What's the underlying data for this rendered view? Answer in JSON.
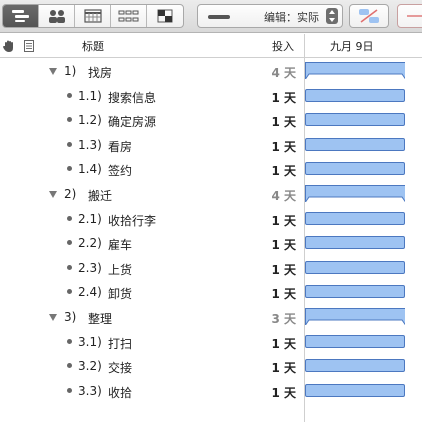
{
  "toolbar": {
    "view_buttons": [
      {
        "icon": "outline-view-icon",
        "active": true
      },
      {
        "icon": "resources-view-icon",
        "active": false
      },
      {
        "icon": "calendar-view-icon",
        "active": false
      },
      {
        "icon": "network-view-icon",
        "active": false
      },
      {
        "icon": "styles-view-icon",
        "active": false
      }
    ],
    "edit_mode_label": "编辑：实际"
  },
  "header": {
    "title_col": "标题",
    "effort_col": "投入",
    "date_col": "九月 9日"
  },
  "colors": {
    "task_bar_fill": "#9ec3f2",
    "task_bar_border": "#4c78c0",
    "active_toolbar": "#5c5c5c"
  },
  "tasks": [
    {
      "level": 0,
      "num": "1)",
      "name": "找房",
      "effort": "4 天",
      "group": true
    },
    {
      "level": 1,
      "num": "1.1)",
      "name": "搜索信息",
      "effort": "1 天",
      "group": false
    },
    {
      "level": 1,
      "num": "1.2)",
      "name": "确定房源",
      "effort": "1 天",
      "group": false
    },
    {
      "level": 1,
      "num": "1.3)",
      "name": "看房",
      "effort": "1 天",
      "group": false
    },
    {
      "level": 1,
      "num": "1.4)",
      "name": "签约",
      "effort": "1 天",
      "group": false
    },
    {
      "level": 0,
      "num": "2)",
      "name": "搬迁",
      "effort": "4 天",
      "group": true
    },
    {
      "level": 1,
      "num": "2.1)",
      "name": "收拾行李",
      "effort": "1 天",
      "group": false
    },
    {
      "level": 1,
      "num": "2.2)",
      "name": "雇车",
      "effort": "1 天",
      "group": false
    },
    {
      "level": 1,
      "num": "2.3)",
      "name": "上货",
      "effort": "1 天",
      "group": false
    },
    {
      "level": 1,
      "num": "2.4)",
      "name": "卸货",
      "effort": "1 天",
      "group": false
    },
    {
      "level": 0,
      "num": "3)",
      "name": "整理",
      "effort": "3 天",
      "group": true
    },
    {
      "level": 1,
      "num": "3.1)",
      "name": "打扫",
      "effort": "1 天",
      "group": false
    },
    {
      "level": 1,
      "num": "3.2)",
      "name": "交接",
      "effort": "1 天",
      "group": false
    },
    {
      "level": 1,
      "num": "3.3)",
      "name": "收拾",
      "effort": "1 天",
      "group": false
    }
  ]
}
